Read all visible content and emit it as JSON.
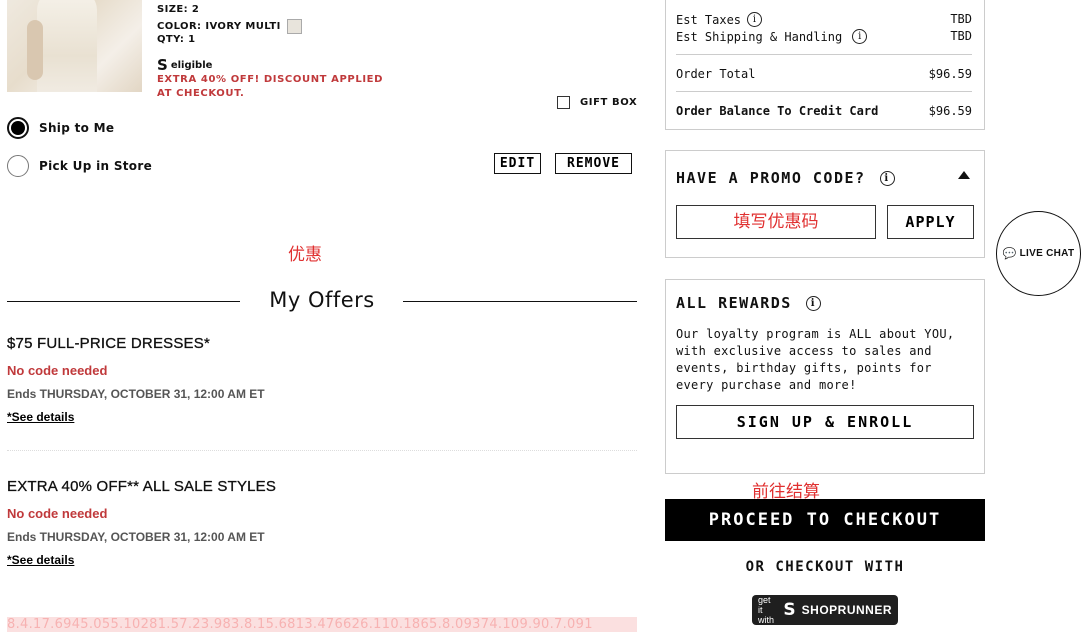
{
  "product": {
    "size_label": "SIZE: 2",
    "color_label": "COLOR: IVORY MULTI",
    "qty_label": "QTY: 1",
    "eligible_label": "eligible",
    "discount_text": "EXTRA 40% OFF! DISCOUNT APPLIED AT CHECKOUT.",
    "gift_box_label": "GIFT BOX",
    "gift_box_checked": false
  },
  "delivery": {
    "ship_to_me": "Ship to Me",
    "pick_up_in_store": "Pick Up in Store",
    "selected": "ship_to_me"
  },
  "item_actions": {
    "edit": "EDIT",
    "remove": "REMOVE"
  },
  "annotations": {
    "offers_cn": "优惠",
    "checkout_cn": "前往结算"
  },
  "offers": {
    "title": "My Offers",
    "items": [
      {
        "title": "$75 FULL-PRICE DRESSES*",
        "code": "No code needed",
        "ends": "Ends THURSDAY, OCTOBER 31, 12:00 AM ET",
        "details": "*See details"
      },
      {
        "title": "EXTRA 40% OFF** ALL SALE STYLES",
        "code": "No code needed",
        "ends": "Ends THURSDAY, OCTOBER 31, 12:00 AM ET",
        "details": "*See details"
      }
    ],
    "noise_text": "8.4.17.6945.055.10281.57.23.983.8.15.6813.476626.110.1865.8.09374.109.90.7.091"
  },
  "summary": {
    "est_taxes_label": "Est Taxes",
    "est_taxes_value": "TBD",
    "est_shipping_label": "Est Shipping & Handling",
    "est_shipping_value": "TBD",
    "order_total_label": "Order Total",
    "order_total_value": "$96.59",
    "balance_label": "Order Balance To Credit Card",
    "balance_value": "$96.59"
  },
  "promo": {
    "title": "HAVE A PROMO CODE?",
    "placeholder": "填写优惠码",
    "apply_label": "APPLY"
  },
  "rewards": {
    "title": "ALL REWARDS",
    "description": "Our loyalty program is ALL about YOU, with exclusive access to sales and events, birthday gifts, points for every purchase and more!",
    "signup_label": "SIGN UP & ENROLL"
  },
  "checkout": {
    "proceed_label": "PROCEED TO CHECKOUT",
    "or_checkout_label": "OR CHECKOUT WITH",
    "shoprunner_getit": "get it with",
    "shoprunner_name": "SHOPRUNNER"
  },
  "live_chat": {
    "label": "LIVE CHAT"
  },
  "colors": {
    "accent_red": "#c0393b",
    "annotation_red": "#e03030",
    "checkout_bg": "#000000"
  }
}
